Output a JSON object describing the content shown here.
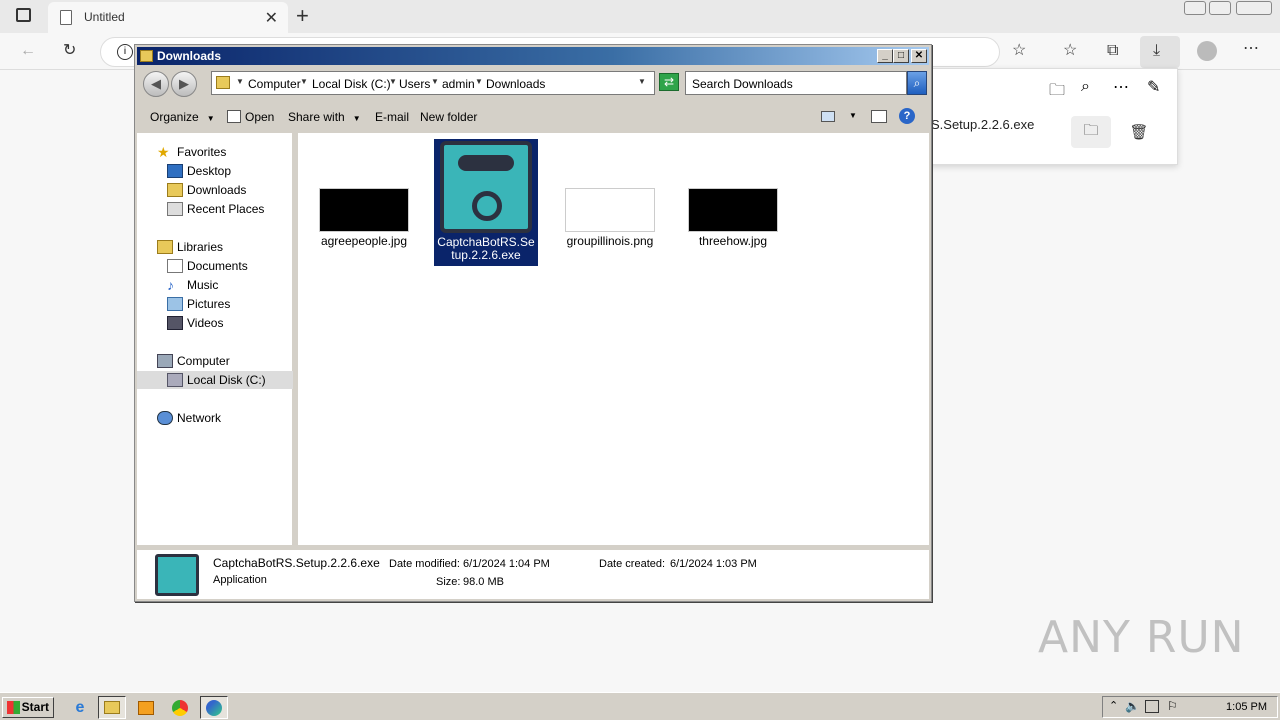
{
  "browser": {
    "tab_title": "Untitled",
    "tab_close": "✕",
    "new_tab": "+"
  },
  "download_panel": {
    "filename": "S.Setup.2.2.6.exe"
  },
  "explorer": {
    "title": "Downloads",
    "breadcrumb": [
      "Computer",
      "Local Disk (C:)",
      "Users",
      "admin",
      "Downloads"
    ],
    "search_placeholder": "Search Downloads",
    "commands": {
      "organize": "Organize",
      "open": "Open",
      "share_with": "Share with",
      "email": "E-mail",
      "new_folder": "New folder"
    },
    "nav": {
      "favorites": "Favorites",
      "desktop": "Desktop",
      "downloads": "Downloads",
      "recent_places": "Recent Places",
      "libraries": "Libraries",
      "documents": "Documents",
      "music": "Music",
      "pictures": "Pictures",
      "videos": "Videos",
      "computer": "Computer",
      "local_disk": "Local Disk (C:)",
      "network": "Network"
    },
    "files": [
      {
        "name": "agreepeople.jpg"
      },
      {
        "name": "CaptchaBotRS.Setup.2.2.6.exe"
      },
      {
        "name": "groupillinois.png"
      },
      {
        "name": "threehow.jpg"
      }
    ],
    "details": {
      "name": "CaptchaBotRS.Setup.2.2.6.exe",
      "type": "Application",
      "modified_label": "Date modified:",
      "modified": "6/1/2024 1:04 PM",
      "created_label": "Date created:",
      "created": "6/1/2024 1:03 PM",
      "size_label": "Size:",
      "size": "98.0 MB"
    }
  },
  "taskbar": {
    "start": "Start",
    "clock": "1:05 PM"
  },
  "watermark": "ANY RUN",
  "colors": {
    "accent": "#0a246a",
    "app_icon": "#3ab5b8"
  }
}
